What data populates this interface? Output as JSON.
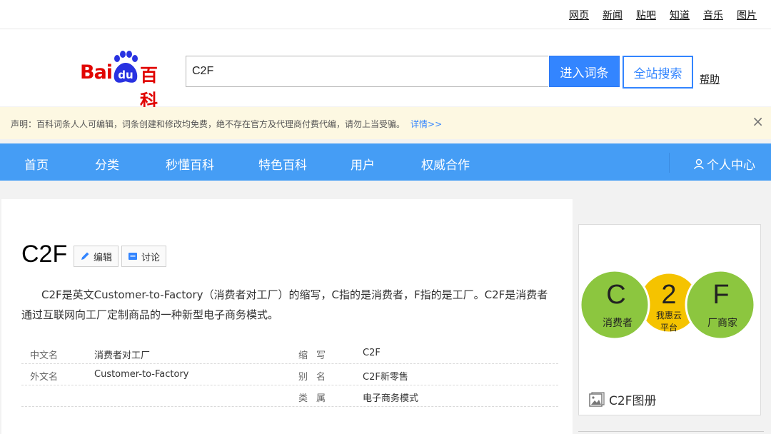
{
  "top_links": [
    "网页",
    "新闻",
    "贴吧",
    "知道",
    "音乐",
    "图片"
  ],
  "logo": {
    "text_bai": "Bai",
    "text_du": "du",
    "text_baike": "百科"
  },
  "search": {
    "value": "C2F",
    "enter_label": "进入词条",
    "all_label": "全站搜索",
    "help_label": "帮助"
  },
  "notice": {
    "text": "声明：百科词条人人可编辑，词条创建和修改均免费，绝不存在官方及代理商付费代编，请勿上当受骗。",
    "more": "详情>>",
    "close": "×"
  },
  "main_nav": [
    "首页",
    "分类",
    "秒懂百科",
    "特色百科",
    "用户",
    "权威合作"
  ],
  "user_center": "个人中心",
  "entry": {
    "title": "C2F",
    "edit_label": "编辑",
    "discuss_label": "讨论",
    "summary": "C2F是英文Customer-to-Factory（消费者对工厂）的缩写，C指的是消费者，F指的是工厂。C2F是消费者通过互联网向工厂定制商品的一种新型电子商务模式。"
  },
  "basic_info": [
    {
      "k1": "中文名",
      "v1": "消费者对工厂",
      "k2": "缩写",
      "v2": "C2F"
    },
    {
      "k1": "外文名",
      "v1": "Customer-to-Factory",
      "k2": "别名",
      "v2": "C2F新零售"
    },
    {
      "k1": "",
      "v1": "",
      "k2": "类属",
      "v2": "电子商务模式"
    }
  ],
  "image": {
    "c_letter": "C",
    "c_label": "消费者",
    "two_letter": "2",
    "two_label_1": "我惠云",
    "two_label_2": "平台",
    "f_letter": "F",
    "f_label": "厂商家",
    "album_label": "C2F图册"
  },
  "colors": {
    "nav_blue": "#459df5",
    "button_blue": "#3385ff",
    "notice_bg": "#fdf8e2",
    "logo_red": "#e10602",
    "green_circle": "#8cc63f",
    "yellow_circle": "#f5c300"
  }
}
